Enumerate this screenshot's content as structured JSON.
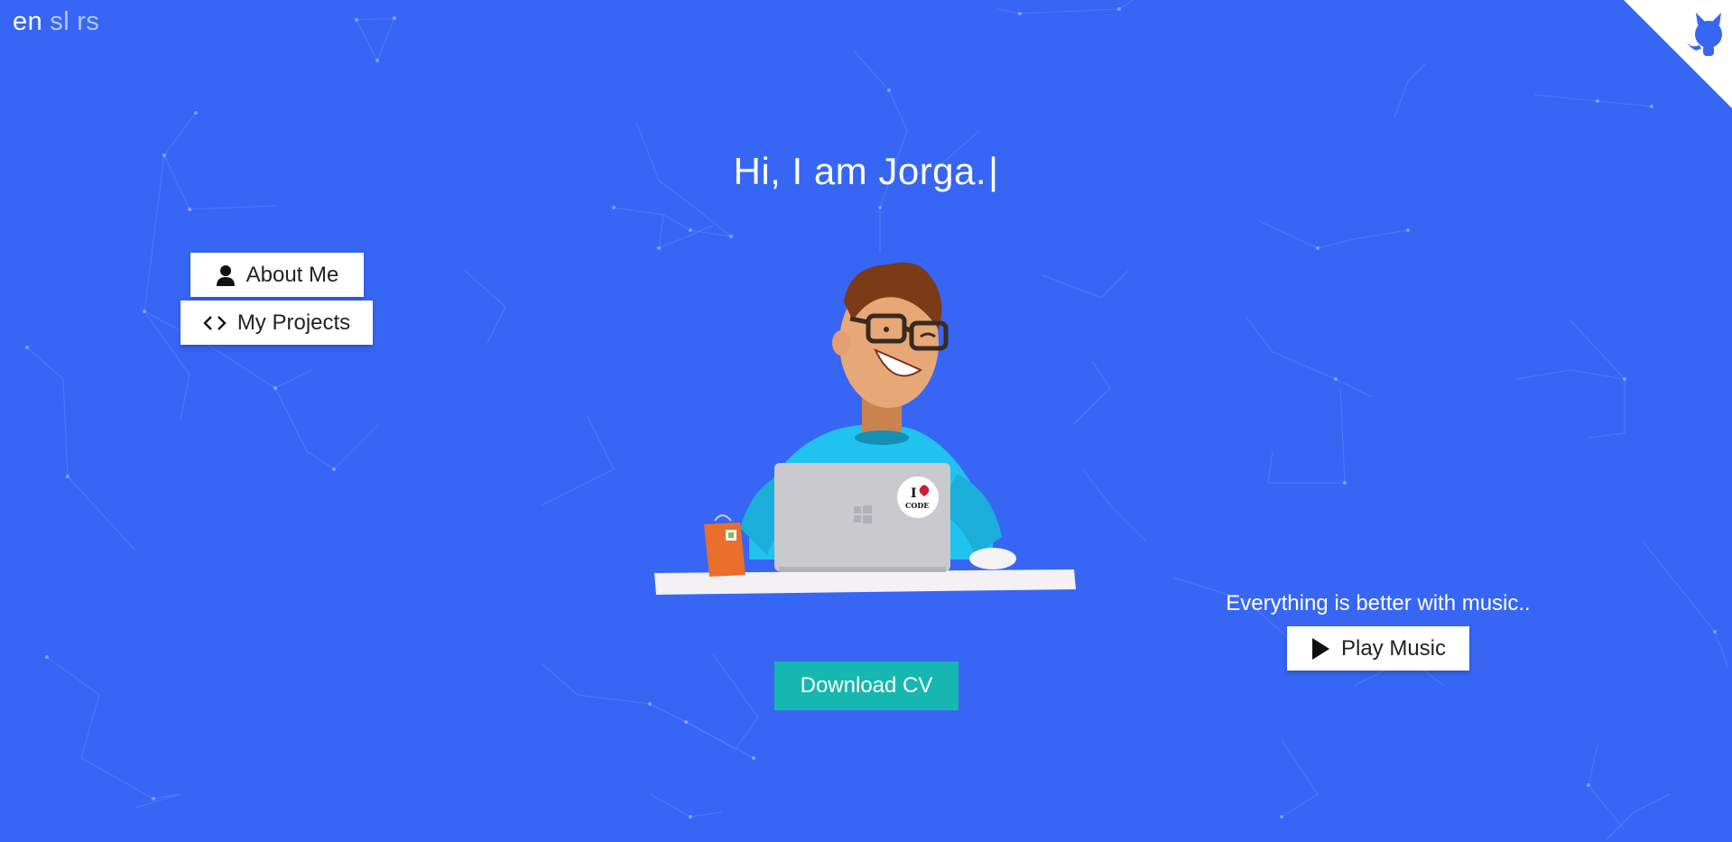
{
  "languages": [
    {
      "code": "en",
      "active": true
    },
    {
      "code": "sl",
      "active": false
    },
    {
      "code": "rs",
      "active": false
    }
  ],
  "github_corner": {
    "icon": "github-octocat-icon"
  },
  "hero": {
    "title": "Hi, I am Jorga.",
    "caret": "|"
  },
  "nav": {
    "about_label": "About Me",
    "about_icon": "user-icon",
    "projects_label": "My Projects",
    "projects_icon": "code-icon"
  },
  "illustration": {
    "sticker_line1": "I",
    "sticker_line2": "CODE"
  },
  "music": {
    "caption": "Everything is better with music..",
    "play_label": "Play Music",
    "play_icon": "play-icon"
  },
  "cv": {
    "download_label": "Download CV"
  },
  "colors": {
    "background": "#3766f5",
    "cv_button": "#16b7b0",
    "white": "#ffffff"
  }
}
